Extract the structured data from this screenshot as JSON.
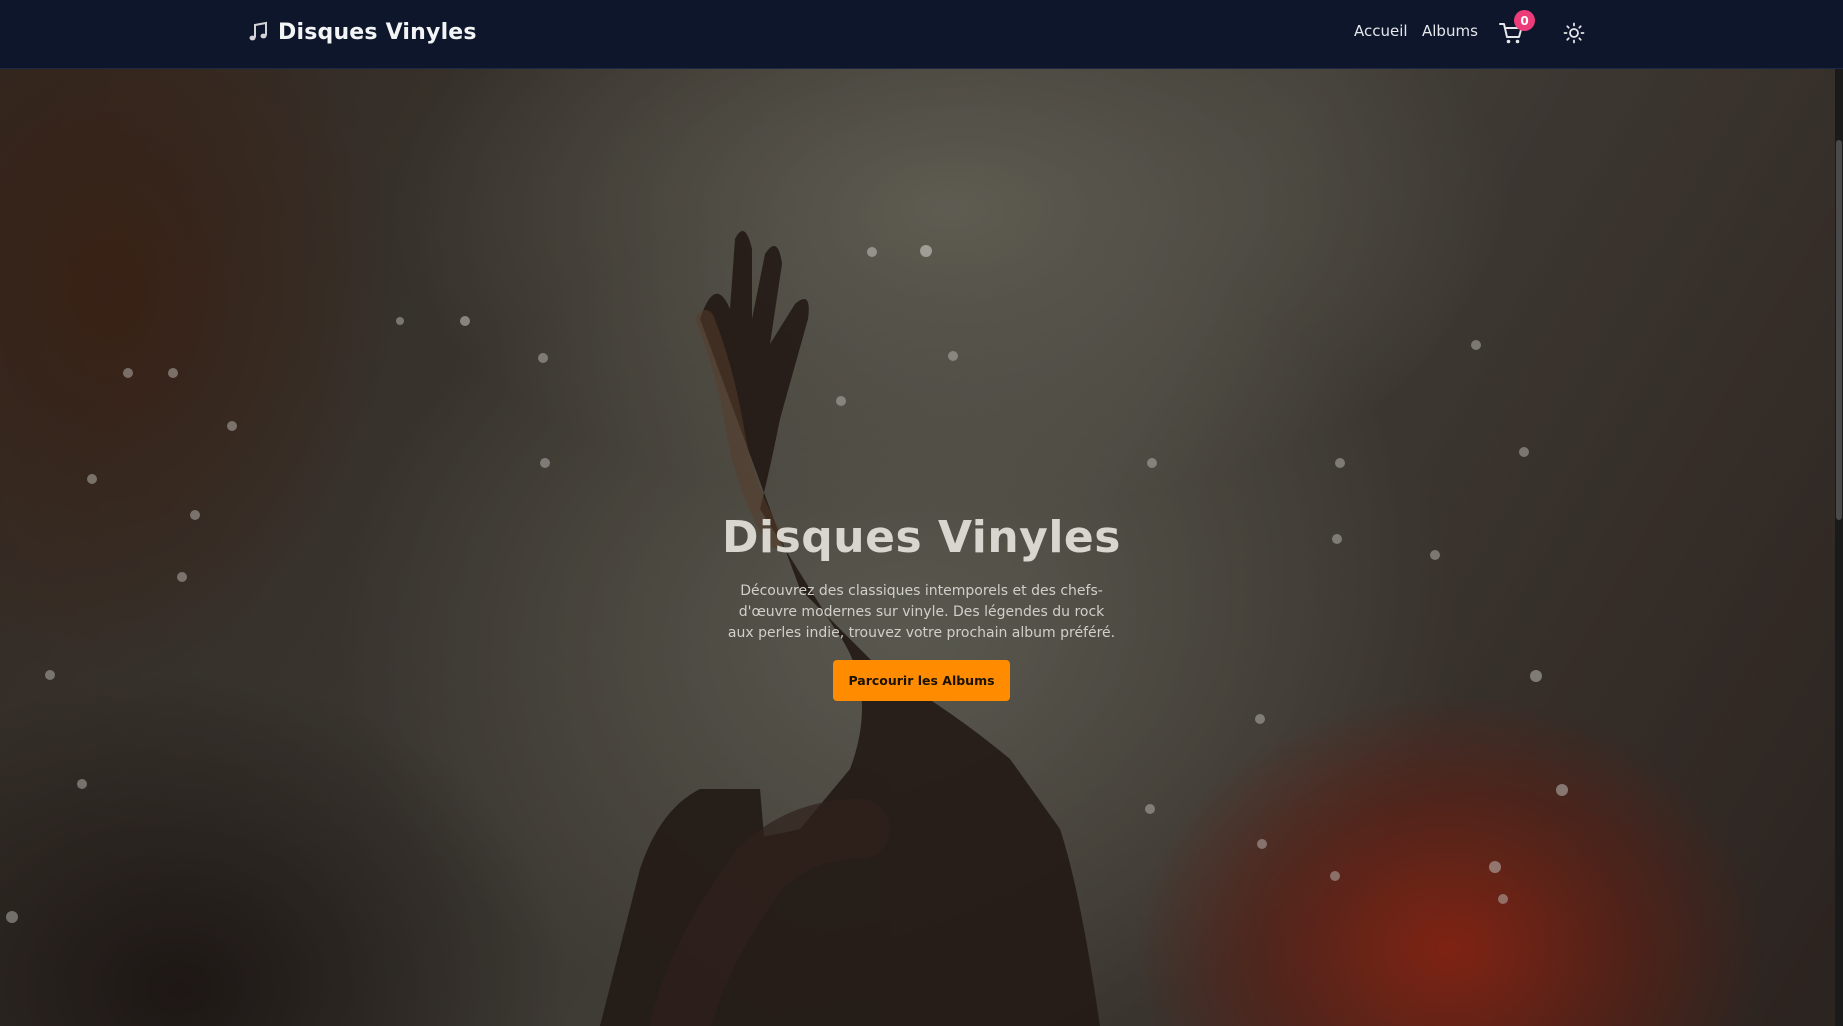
{
  "navbar": {
    "brand": "Disques Vinyles",
    "brand_icon": "music-note-icon",
    "links": [
      "Accueil",
      "Albums"
    ],
    "cart_count": "0",
    "cart_icon": "cart-icon",
    "theme_icon": "sun-icon"
  },
  "hero": {
    "title": "Disques Vinyles",
    "description": "Découvrez des classiques intemporels et des chefs-d'œuvre modernes sur vinyle. Des légendes du rock aux perles indie, trouvez votre prochain album préféré.",
    "cta_label": "Parcourir les Albums"
  },
  "colors": {
    "navbar_bg": "#0d162b",
    "accent": "#ff8c00",
    "badge": "#ec3d7a"
  }
}
